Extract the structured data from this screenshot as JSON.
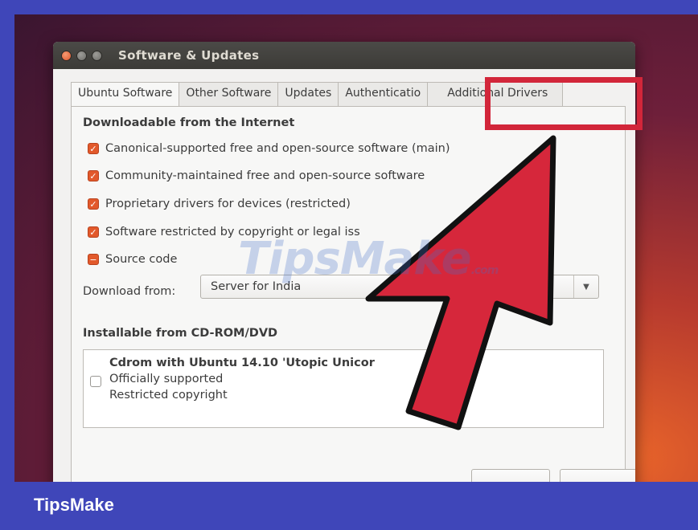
{
  "window": {
    "title": "Software & Updates"
  },
  "tabs": [
    {
      "label": "Ubuntu Software",
      "active": true
    },
    {
      "label": "Other Software",
      "active": false
    },
    {
      "label": "Updates",
      "active": false
    },
    {
      "label": "Authenticatio",
      "active": false
    },
    {
      "label": "Additional Drivers",
      "active": false
    }
  ],
  "downloadable": {
    "heading": "Downloadable from the Internet",
    "items": [
      {
        "label": "Canonical-supported free and open-source software (main)",
        "state": "checked"
      },
      {
        "label": "Community-maintained free and open-source software",
        "state": "checked"
      },
      {
        "label": "Proprietary drivers for devices (restricted)",
        "state": "checked"
      },
      {
        "label": "Software restricted by copyright or legal iss",
        "state": "checked"
      },
      {
        "label": "Source code",
        "state": "mixed"
      }
    ],
    "download_from_label": "Download from:",
    "server_value": "Server for India"
  },
  "installable": {
    "heading": "Installable from CD-ROM/DVD",
    "cd_title": "Cdrom with Ubuntu 14.10 'Utopic Unicor",
    "cd_line1": "Officially supported",
    "cd_line2": "Restricted copyright"
  },
  "watermark": {
    "text": "TipsMake",
    "suffix": ".com"
  },
  "footer": {
    "brand": "TipsMake"
  },
  "colors": {
    "frame": "#3f46b9",
    "highlight": "#d2263a",
    "arrow": "#d6273b",
    "checkbox": "#e2592b"
  }
}
